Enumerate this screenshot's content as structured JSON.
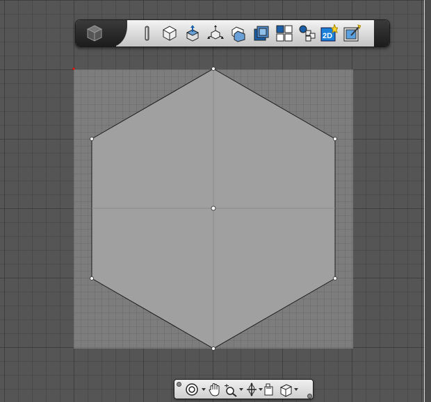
{
  "viewport": {
    "background_color": "#555555",
    "grid_color": "#3e3e3e",
    "plane_color": "#7d7d7d",
    "shape": {
      "type": "hexagon",
      "fill": "#a0a0a0",
      "stroke": "#1a1a1a",
      "vertices": [
        "top",
        "upper-right",
        "lower-right",
        "bottom",
        "lower-left",
        "upper-left"
      ],
      "center_point": true
    },
    "origin_marker_color": "#ff0000"
  },
  "top_toolbar": {
    "tools": [
      {
        "name": "view-cube",
        "icon": "view-cube-icon"
      },
      {
        "name": "divider",
        "icon": "pencil-icon"
      },
      {
        "name": "box",
        "icon": "box-icon"
      },
      {
        "name": "extrude",
        "icon": "extrude-icon"
      },
      {
        "name": "move",
        "icon": "move-icon"
      },
      {
        "name": "intersect",
        "icon": "intersect-icon"
      },
      {
        "name": "shell",
        "icon": "shell-icon"
      },
      {
        "name": "grid",
        "icon": "grid-icon"
      },
      {
        "name": "pattern",
        "icon": "pattern-icon"
      },
      {
        "name": "sketch-2d",
        "icon": "sketch-2d-icon",
        "label": "2D"
      },
      {
        "name": "materials",
        "icon": "materials-icon"
      }
    ]
  },
  "bottom_toolbar": {
    "tools": [
      {
        "name": "orbit",
        "icon": "orbit-icon"
      },
      {
        "name": "pan",
        "icon": "hand-icon"
      },
      {
        "name": "zoom",
        "icon": "zoom-icon"
      },
      {
        "name": "fit",
        "icon": "fit-icon"
      },
      {
        "name": "view",
        "icon": "view-icon"
      }
    ]
  }
}
